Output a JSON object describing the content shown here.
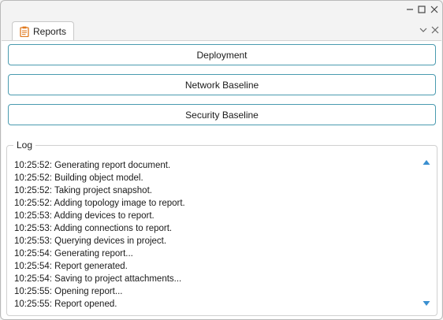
{
  "tab": {
    "label": "Reports",
    "icon": "clipboard-icon"
  },
  "window_controls": [
    "minimize-icon",
    "maximize-icon",
    "close-icon"
  ],
  "buttons": {
    "deployment": "Deployment",
    "network_baseline": "Network Baseline",
    "security_baseline": "Security Baseline"
  },
  "log": {
    "label": "Log",
    "lines": [
      "10:25:52: Generating report document.",
      "10:25:52: Building object model.",
      "10:25:52: Taking project snapshot.",
      "10:25:52: Adding topology image to report.",
      "10:25:53: Adding devices to report.",
      "10:25:53: Adding connections to report.",
      "10:25:53: Querying devices in project.",
      "10:25:54: Generating report...",
      "10:25:54: Report generated.",
      "10:25:54: Saving to project attachments...",
      "10:25:55: Opening report...",
      "10:25:55: Report opened."
    ]
  },
  "colors": {
    "button_border": "#4a9bb0",
    "scroll_arrow": "#3a8fd0",
    "tab_icon": "#e07a1f"
  }
}
